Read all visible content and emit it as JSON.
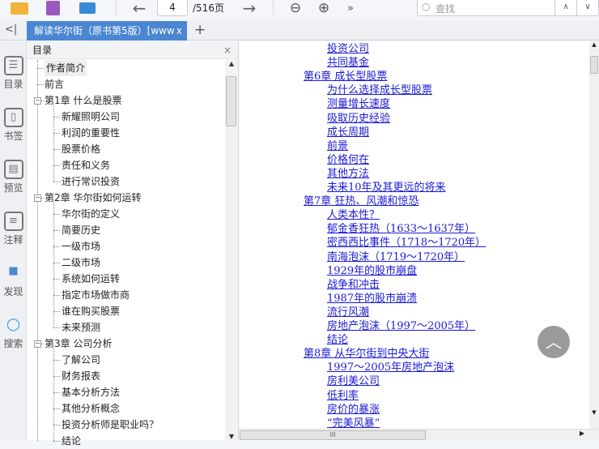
{
  "toolbar": {
    "page": "4",
    "total": "/516页",
    "search_placeholder": "查找"
  },
  "tab": {
    "title": "解读华尔街（原书第5版）[www",
    "close": "x",
    "new": "+"
  },
  "rail": [
    {
      "label": "目录"
    },
    {
      "label": "书签"
    },
    {
      "label": "预览"
    },
    {
      "label": "注释"
    },
    {
      "label": "发现"
    },
    {
      "label": "搜索"
    }
  ],
  "toc": {
    "title": "目录",
    "close": "×",
    "items": [
      {
        "label": "作者简介",
        "level": 0
      },
      {
        "label": "前言",
        "level": 0
      },
      {
        "label": "第1章 什么是股票",
        "level": 0,
        "expanded": true
      },
      {
        "label": "新耀照明公司",
        "level": 1
      },
      {
        "label": "利润的重要性",
        "level": 1
      },
      {
        "label": "股票价格",
        "level": 1
      },
      {
        "label": "责任和义务",
        "level": 1
      },
      {
        "label": "进行常识投资",
        "level": 1
      },
      {
        "label": "第2章 华尔街如何运转",
        "level": 0,
        "expanded": true
      },
      {
        "label": "华尔街的定义",
        "level": 1
      },
      {
        "label": "简要历史",
        "level": 1
      },
      {
        "label": "一级市场",
        "level": 1
      },
      {
        "label": "二级市场",
        "level": 1
      },
      {
        "label": "系统如何运转",
        "level": 1
      },
      {
        "label": "指定市场做市商",
        "level": 1
      },
      {
        "label": "谁在购买股票",
        "level": 1
      },
      {
        "label": "未来预测",
        "level": 1
      },
      {
        "label": "第3章 公司分析",
        "level": 0,
        "expanded": true
      },
      {
        "label": "了解公司",
        "level": 1
      },
      {
        "label": "财务报表",
        "level": 1
      },
      {
        "label": "基本分析方法",
        "level": 1
      },
      {
        "label": "其他分析概念",
        "level": 1
      },
      {
        "label": "投资分析师是职业吗？",
        "level": 1
      },
      {
        "label": "结论",
        "level": 1
      }
    ]
  },
  "content": {
    "lines": [
      {
        "text": "投资公司",
        "level": 1
      },
      {
        "text": "共同基金",
        "level": 1
      },
      {
        "text": "第6章  成长型股票",
        "level": 0
      },
      {
        "text": "为什么选择成长型股票",
        "level": 1
      },
      {
        "text": "测量增长速度",
        "level": 1
      },
      {
        "text": "吸取历史经验",
        "level": 1
      },
      {
        "text": "成长周期",
        "level": 1
      },
      {
        "text": "前景",
        "level": 1
      },
      {
        "text": "价格何在",
        "level": 1
      },
      {
        "text": "其他方法",
        "level": 1
      },
      {
        "text": "未来10年及其更远的将来",
        "level": 1
      },
      {
        "text": "第7章  狂热、风潮和惊恐",
        "level": 0
      },
      {
        "text": "人类本性？",
        "level": 1
      },
      {
        "text": "郁金香狂热（1633～1637年）",
        "level": 1
      },
      {
        "text": "密西西比事件（1718～1720年）",
        "level": 1
      },
      {
        "text": "南海泡沫（1719～1720年）",
        "level": 1
      },
      {
        "text": "1929年的股市崩盘",
        "level": 1
      },
      {
        "text": "战争和冲击",
        "level": 1
      },
      {
        "text": "1987年的股市崩溃",
        "level": 1
      },
      {
        "text": "流行风潮",
        "level": 1
      },
      {
        "text": "房地产泡沫（1997～2005年）",
        "level": 1
      },
      {
        "text": "结论",
        "level": 1
      },
      {
        "text": "第8章  从华尔街到中央大街",
        "level": 0
      },
      {
        "text": "1997～2005年房地产泡沫",
        "level": 1
      },
      {
        "text": "房利美公司",
        "level": 1
      },
      {
        "text": "低利率",
        "level": 1
      },
      {
        "text": "房价的暴涨",
        "level": 1
      },
      {
        "text": "“完美风暴”",
        "level": 1
      }
    ]
  },
  "colors": {
    "accent": "#4a86d1",
    "link": "#1a1ad6"
  }
}
